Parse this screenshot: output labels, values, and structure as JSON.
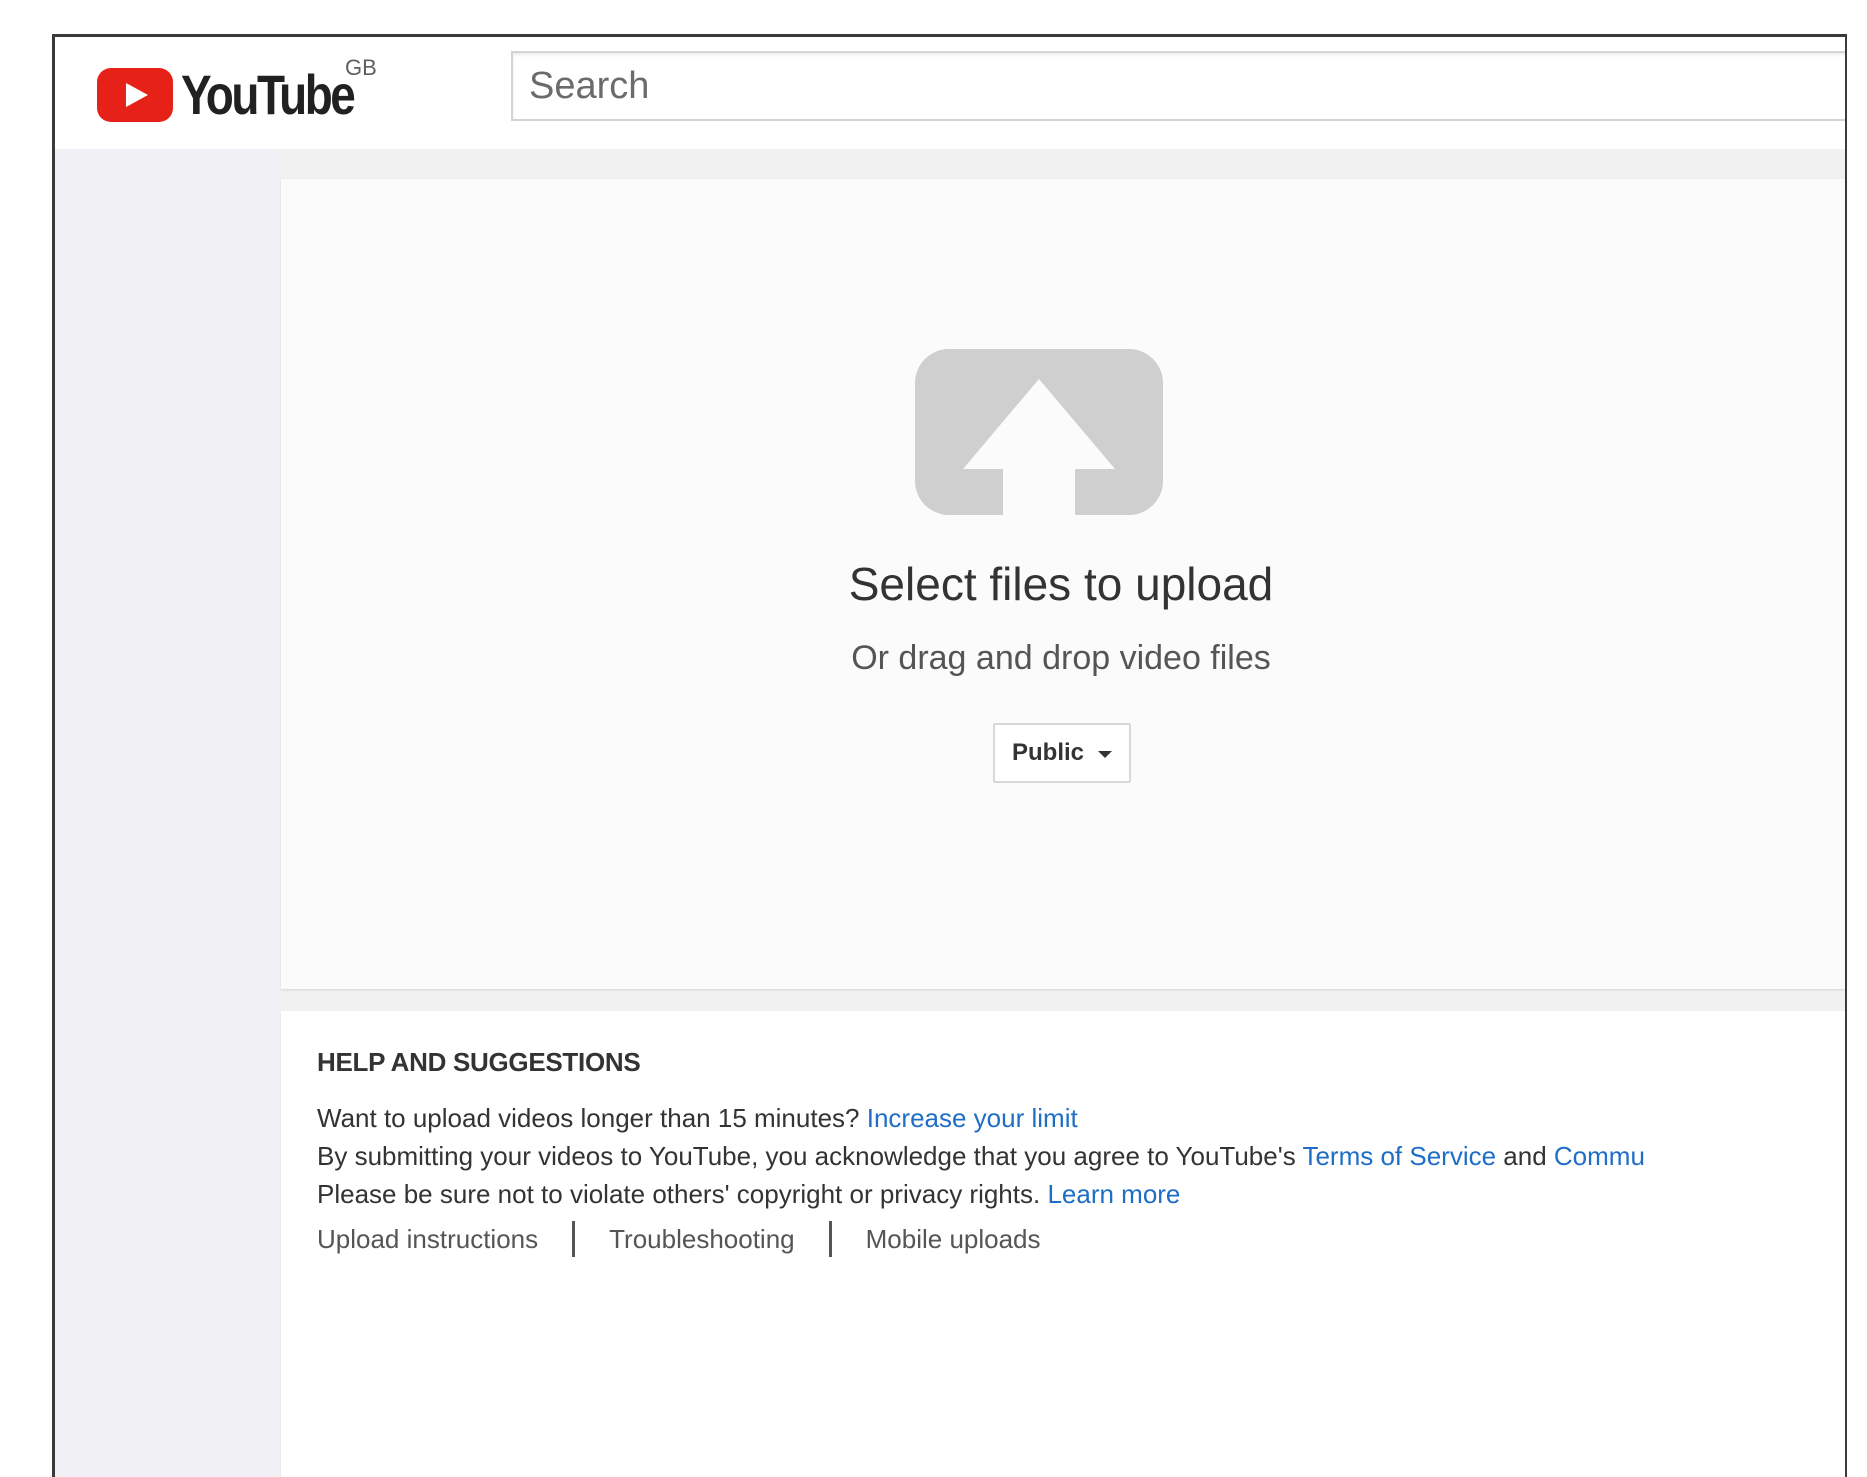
{
  "header": {
    "logo_text": "YouTube",
    "country_code": "GB",
    "search_placeholder": "Search",
    "brand_color": "#e62117"
  },
  "upload": {
    "icon": "upload-arrow-icon",
    "title": "Select files to upload",
    "subtitle": "Or drag and drop video files",
    "privacy_value": "Public"
  },
  "help": {
    "heading": "HELP AND SUGGESTIONS",
    "line1_text": "Want to upload videos longer than 15 minutes? ",
    "line1_link": "Increase your limit",
    "line2_text": "By submitting your videos to YouTube, you acknowledge that you agree to YouTube's ",
    "line2_link1": "Terms of Service",
    "line2_mid": " and ",
    "line2_link2": "Commu",
    "line3_text": "Please be sure not to violate others' copyright or privacy rights. ",
    "line3_link": "Learn more",
    "footer_links": [
      "Upload instructions",
      "Troubleshooting",
      "Mobile uploads"
    ],
    "link_color": "#1e6ec6"
  }
}
